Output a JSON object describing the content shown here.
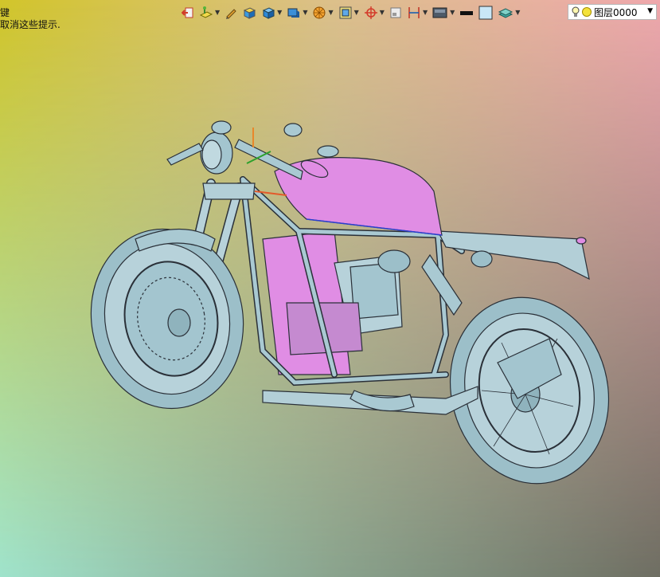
{
  "hint": {
    "line1": "键",
    "line2": "取消这些提示."
  },
  "toolbar": {
    "buttons": [
      {
        "name": "exit-sketch-icon",
        "dropdown": false
      },
      {
        "name": "datum-plane-icon",
        "dropdown": true
      },
      {
        "name": "pen-icon",
        "dropdown": false
      },
      {
        "name": "solid-box-icon",
        "dropdown": false
      },
      {
        "name": "cube-view-icon",
        "dropdown": true
      },
      {
        "name": "render-style-icon",
        "dropdown": true
      },
      {
        "name": "sphere-grid-icon",
        "dropdown": true
      },
      {
        "name": "section-view-icon",
        "dropdown": true
      },
      {
        "name": "snap-target-icon",
        "dropdown": true
      },
      {
        "name": "frame-icon",
        "dropdown": false
      },
      {
        "name": "dimension-icon",
        "dropdown": true
      },
      {
        "name": "display-mode-icon",
        "dropdown": true
      },
      {
        "name": "line-color-swatch-icon",
        "dropdown": false
      },
      {
        "name": "fill-color-swatch-icon",
        "dropdown": false
      },
      {
        "name": "layer-stack-icon",
        "dropdown": true
      }
    ]
  },
  "layer": {
    "name": "图层0000"
  },
  "colors": {
    "bg_top_left": "#d2c52a",
    "bg_top_right": "#efa8ad",
    "bg_bottom_left": "#9fe3cc",
    "bg_bottom_right": "#6e6e62",
    "metal": "#a9c9d2",
    "highlight_part": "#e08de4",
    "outline": "#2a3038"
  }
}
